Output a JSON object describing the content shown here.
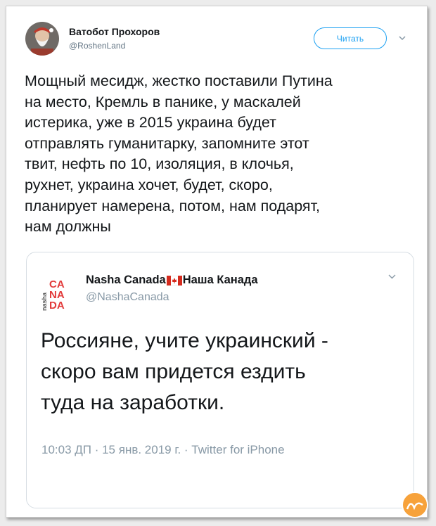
{
  "tweet": {
    "author_name": "Ватобот Прохоров",
    "author_handle": "@RoshenLand",
    "follow_label": "Читать",
    "text_lines": [
      "Мощный месидж, жестко поставили Путина",
      "на место, Кремль в панике, у маскалей",
      "истерика, уже в 2015 украина будет",
      "отправлять гуманитарку, запомните этот",
      "твит, нефть по 10, изоляция, в клочья,",
      "рухнет, украина хочет, будет, скоро,",
      "планирует намерена, потом, нам подарят,",
      "нам должны"
    ]
  },
  "quoted": {
    "name_part1": "Nasha Canada",
    "name_part2": "Наша Канада",
    "handle": "@NashaCanada",
    "logo_text": "nasha CA NA DA",
    "text_lines": [
      "Россияне, учите украинский -",
      "скоро вам придется ездить",
      "туда на заработки."
    ],
    "meta": "10:03 ДП · 15 янв. 2019 г. · Twitter for iPhone"
  },
  "icons": {
    "avatar": "avatar-santa",
    "chevron": "chevron-down-icon",
    "flag": "canada-flag-icon",
    "watermark": "watermark-logo"
  },
  "colors": {
    "accent": "#1da1f2",
    "text": "#14171a",
    "muted": "#8899a6",
    "logo_red": "#e23a3a"
  }
}
